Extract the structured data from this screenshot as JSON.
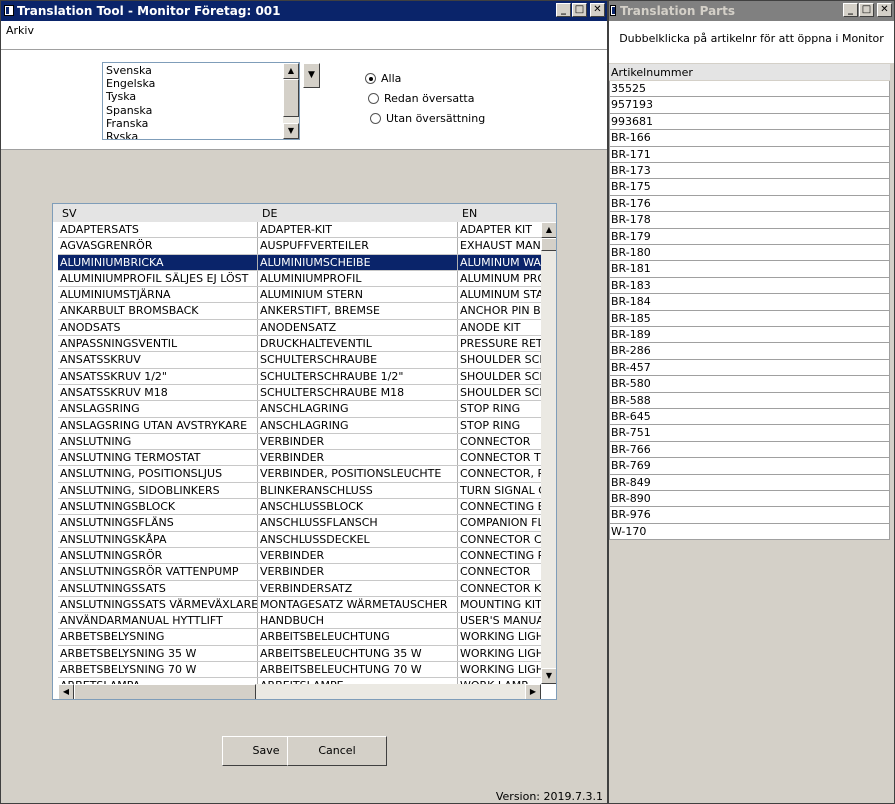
{
  "main_window": {
    "title": "Translation Tool - Monitor Företag: 001",
    "menu": [
      "Arkiv"
    ],
    "language_list": [
      "Svenska",
      "Engelska",
      "Tyska",
      "Spanska",
      "Franska",
      "Ryska"
    ],
    "filters": [
      {
        "label": "Alla",
        "selected": true
      },
      {
        "label": "Redan översatta",
        "selected": false
      },
      {
        "label": "Utan översättning",
        "selected": false
      }
    ],
    "grid": {
      "columns": [
        "SV",
        "DE",
        "EN"
      ],
      "selected_row": 2,
      "rows": [
        [
          "ADAPTERSATS",
          "ADAPTER-KIT",
          "ADAPTER KIT"
        ],
        [
          "AGVASGRENRÖR",
          "AUSPUFFVERTEILER",
          "EXHAUST MANIF"
        ],
        [
          "ALUMINIUMBRICKA",
          "ALUMINIUMSCHEIBE",
          "ALUMINUM WAS"
        ],
        [
          "ALUMINIUMPROFIL SÄLJES EJ LÖST",
          "ALUMINIUMPROFIL",
          "ALUMINUM PRO"
        ],
        [
          "ALUMINIUMSTJÄRNA",
          "ALUMINIUM STERN",
          "ALUMINUM STAF"
        ],
        [
          "ANKARBULT BROMSBACK",
          "ANKERSTIFT, BREMSE",
          "ANCHOR PIN BR"
        ],
        [
          "ANODSATS",
          "ANODENSATZ",
          "ANODE KIT"
        ],
        [
          "ANPASSNINGSVENTIL",
          "DRUCKHALTEVENTIL",
          "PRESSURE RETA"
        ],
        [
          "ANSATSSKRUV",
          "SCHULTERSCHRAUBE",
          "SHOULDER SCRE"
        ],
        [
          "ANSATSSKRUV 1/2\"",
          "SCHULTERSCHRAUBE 1/2\"",
          "SHOULDER SCRE"
        ],
        [
          "ANSATSSKRUV M18",
          "SCHULTERSCHRAUBE M18",
          "SHOULDER SCRE"
        ],
        [
          "ANSLAGSRING",
          "ANSCHLAGRING",
          "STOP RING"
        ],
        [
          "ANSLAGSRING UTAN AVSTRYKARE",
          "ANSCHLAGRING",
          "STOP RING"
        ],
        [
          "ANSLUTNING",
          "VERBINDER",
          "CONNECTOR"
        ],
        [
          "ANSLUTNING TERMOSTAT",
          "VERBINDER",
          "CONNECTOR TH"
        ],
        [
          "ANSLUTNING, POSITIONSLJUS",
          "VERBINDER, POSITIONSLEUCHTE",
          "CONNECTOR, PC"
        ],
        [
          "ANSLUTNING, SIDOBLINKERS",
          "BLINKERANSCHLUSS",
          "TURN SIGNAL CC"
        ],
        [
          "ANSLUTNINGSBLOCK",
          "ANSCHLUSSBLOCK",
          "CONNECTING BL"
        ],
        [
          "ANSLUTNINGSFLÄNS",
          "ANSCHLUSSFLANSCH",
          "COMPANION FLA"
        ],
        [
          "ANSLUTNINGSKÅPA",
          "ANSCHLUSSDECKEL",
          "CONNECTOR CA"
        ],
        [
          "ANSLUTNINGSRÖR",
          "VERBINDER",
          "CONNECTING PI"
        ],
        [
          "ANSLUTNINGSRÖR VATTENPUMP",
          "VERBINDER",
          "CONNECTOR"
        ],
        [
          "ANSLUTNINGSSATS",
          "VERBINDERSATZ",
          "CONNECTOR KIT"
        ],
        [
          "ANSLUTNINGSSATS VÄRMEVÄXLARE",
          "MONTAGESATZ WÄRMETAUSCHER",
          "MOUNTING KIT"
        ],
        [
          "ANVÄNDARMANUAL HYTTLIFT",
          "HANDBUCH",
          "USER'S MANUAL"
        ],
        [
          "ARBETSBELYSNING",
          "ARBEITSBELEUCHTUNG",
          "WORKING LIGHT"
        ],
        [
          "ARBETSBELYSNING 35 W",
          "ARBEITSBELEUCHTUNG 35 W",
          "WORKING LIGHT"
        ],
        [
          "ARBETSBELYSNING 70 W",
          "ARBEITSBELEUCHTUNG 70 W",
          "WORKING LIGHT"
        ],
        [
          "ARBETSLAMPA",
          "ARBEITSLAMPE",
          "WORK LAMP"
        ]
      ]
    },
    "buttons": {
      "save": "Save",
      "cancel": "Cancel"
    },
    "version": "Version: 2019.7.3.1"
  },
  "parts_window": {
    "title": "Translation Parts",
    "hint": "Dubbelklicka på artikelnr för att öppna i Monitor",
    "column": "Artikelnummer",
    "items": [
      "35525",
      "957193",
      "993681",
      "BR-166",
      "BR-171",
      "BR-173",
      "BR-175",
      "BR-176",
      "BR-178",
      "BR-179",
      "BR-180",
      "BR-181",
      "BR-183",
      "BR-184",
      "BR-185",
      "BR-189",
      "BR-286",
      "BR-457",
      "BR-580",
      "BR-588",
      "BR-645",
      "BR-751",
      "BR-766",
      "BR-769",
      "BR-849",
      "BR-890",
      "BR-976",
      "W-170"
    ]
  }
}
